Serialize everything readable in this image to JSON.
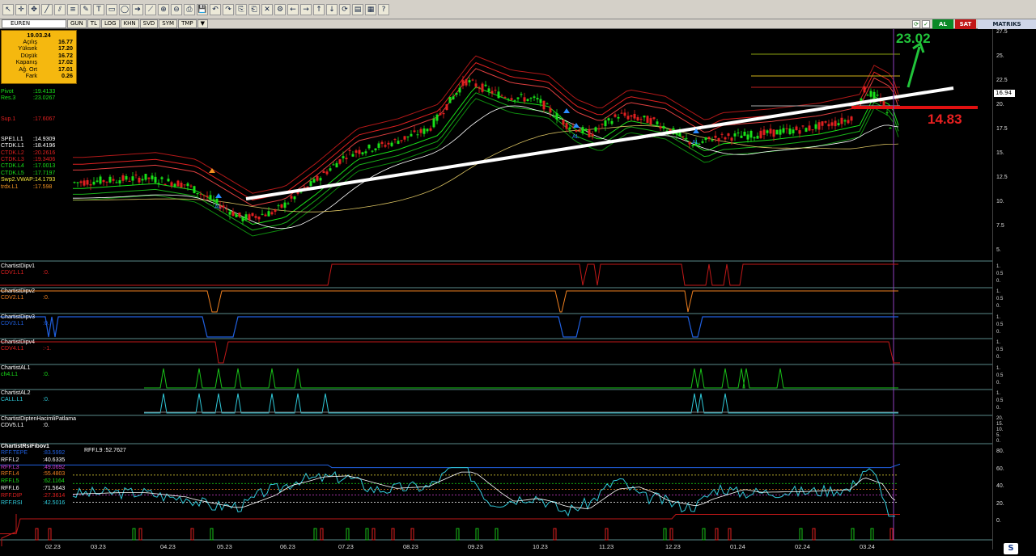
{
  "toolbar": {
    "icons": [
      "select-icon",
      "crosshair-icon",
      "move-icon",
      "line-icon",
      "channel-icon",
      "fibonacci-icon",
      "pencil-icon",
      "text-icon",
      "rect-icon",
      "ellipse-icon",
      "arrow-icon",
      "trend-icon",
      "zoom-in-icon",
      "zoom-out-icon",
      "print-icon",
      "save-icon",
      "undo-icon",
      "redo-icon",
      "copy-icon",
      "paste-icon",
      "delete-icon",
      "settings-icon",
      "left-icon",
      "right-icon",
      "up-icon",
      "down-icon",
      "refresh-icon",
      "chart-icon",
      "template-icon",
      "help-icon"
    ],
    "glyphs": [
      "↖",
      "✛",
      "✥",
      "╱",
      "⫽",
      "≡",
      "✎",
      "T",
      "▭",
      "◯",
      "➔",
      "⟋",
      "⊕",
      "⊖",
      "⎙",
      "💾",
      "↶",
      "↷",
      "⎘",
      "⎗",
      "✕",
      "⚙",
      "←",
      "→",
      "↑",
      "↓",
      "⟳",
      "▤",
      "▦",
      "?"
    ]
  },
  "symbar": {
    "symbol": "EUREN",
    "periods": [
      "GUN",
      "TL",
      "LOG",
      "KHN",
      "SVD",
      "SYM",
      "TMP",
      "▼"
    ],
    "buy_label": "AL",
    "sell_label": "SAT",
    "brand": "MATRIKS"
  },
  "databox": {
    "date": "19.03.24",
    "rows": [
      {
        "label": "Açılış",
        "value": "16.77"
      },
      {
        "label": "Yüksek",
        "value": "17.20"
      },
      {
        "label": "Düşük",
        "value": "16.72"
      },
      {
        "label": "Kapanış",
        "value": "17.02"
      },
      {
        "label": "Ağ. Ort",
        "value": "17.01"
      },
      {
        "label": "Fark",
        "value": "0.26"
      }
    ]
  },
  "legend": [
    {
      "name": "Pivot",
      "value": ":19.4133",
      "color": "#19e019"
    },
    {
      "name": "Res.3",
      "value": ":23.0267",
      "color": "#19e019"
    },
    {
      "name": "",
      "value": "",
      "color": "#000"
    },
    {
      "name": "",
      "value": "",
      "color": "#000"
    },
    {
      "name": "Sup.1",
      "value": ":17.6067",
      "color": "#e02020"
    },
    {
      "name": "",
      "value": "",
      "color": "#000"
    },
    {
      "name": "",
      "value": "",
      "color": "#000"
    },
    {
      "name": "SPE1.L1",
      "value": ":14.9309",
      "color": "#ffffff"
    },
    {
      "name": "CTDK.L1",
      "value": ":18.4196",
      "color": "#ffffff"
    },
    {
      "name": "CTDK.L2",
      "value": ":20.2616",
      "color": "#e02020"
    },
    {
      "name": "CTDK.L3",
      "value": ":19.3406",
      "color": "#e02020"
    },
    {
      "name": "CTDK.L4",
      "value": ":17.0013",
      "color": "#19e019"
    },
    {
      "name": "CTDK.L5",
      "value": ":17.7197",
      "color": "#19e019"
    },
    {
      "name": "Swp2.VWAP",
      "value": ":14.1793",
      "color": "#f2e23a"
    },
    {
      "name": "trdx.L1",
      "value": ":17.598",
      "color": "#f09020"
    }
  ],
  "annotations": {
    "target_up": "23.02",
    "target_down": "14.83",
    "signal_label": "AL"
  },
  "price_axis": {
    "ticks": [
      "27.5",
      "25.",
      "22.5",
      "20.",
      "17.5",
      "15.",
      "12.5",
      "10.",
      "7.5",
      "5."
    ],
    "last_price": "16.94"
  },
  "panes": [
    {
      "title": "ChartistDipv1",
      "line": "CDV1.L1",
      "value": ":0.",
      "color": "#e02020"
    },
    {
      "title": "ChartistDipv2",
      "line": "CDV2.L1",
      "value": ":0.",
      "color": "#f08020"
    },
    {
      "title": "ChartistDipv3",
      "line": "CDV3.L1",
      "value": ":0.",
      "color": "#2060e0"
    },
    {
      "title": "ChartistDipv4",
      "line": "CDV4.L1",
      "value": ":-1.",
      "color": "#e02020"
    },
    {
      "title": "ChartistAL1",
      "line": "ch4.L1",
      "value": ":0.",
      "color": "#19e019"
    },
    {
      "title": "ChartistAL2",
      "line": "CALL.L1",
      "value": ":0.",
      "color": "#30d0e0"
    },
    {
      "title": "ChartistDiptenHacimliPatlama",
      "line": "CDV5.L1",
      "value": ":0.",
      "color": "#ffffff"
    }
  ],
  "pane_ticks": {
    "small": [
      "1.",
      "0.5",
      "0."
    ],
    "cdv5": [
      "20.",
      "15.",
      "10.",
      "5.",
      "0."
    ],
    "rsi": [
      "80.",
      "60.",
      "40.",
      "20.",
      "0."
    ]
  },
  "rsi_pane": {
    "title": "ChartistRsiFibov1",
    "extra": "RFF.L9     :52.7627",
    "rows": [
      {
        "name": "RFF.TEPE",
        "value": ":83.5992",
        "color": "#2060e0"
      },
      {
        "name": "RFF.L2",
        "value": ":40.6335",
        "color": "#ffffff"
      },
      {
        "name": "RFF.L3",
        "value": ":49.0692",
        "color": "#d040d0"
      },
      {
        "name": "RFF.L4",
        "value": ":55.4803",
        "color": "#f08020"
      },
      {
        "name": "RFF.L5",
        "value": ":62.1164",
        "color": "#19e019"
      },
      {
        "name": "RFF.L6",
        "value": ":71.5643",
        "color": "#ffffff"
      },
      {
        "name": "RFF.DIP",
        "value": ":27.3614",
        "color": "#e02020"
      },
      {
        "name": "RFF.RSI",
        "value": ":42.5016",
        "color": "#30d0e0"
      }
    ]
  },
  "date_axis": [
    "02.23",
    "03.23",
    "04.23",
    "05.23",
    "06.23",
    "07.23",
    "08.23",
    "09.23",
    "10.23",
    "11.23",
    "12.23",
    "01.24",
    "02.24",
    "03.24"
  ],
  "colors": {
    "up_candle": "#19e019",
    "down_candle": "#e02020",
    "trendline": "#ffffff",
    "background": "#000000"
  }
}
